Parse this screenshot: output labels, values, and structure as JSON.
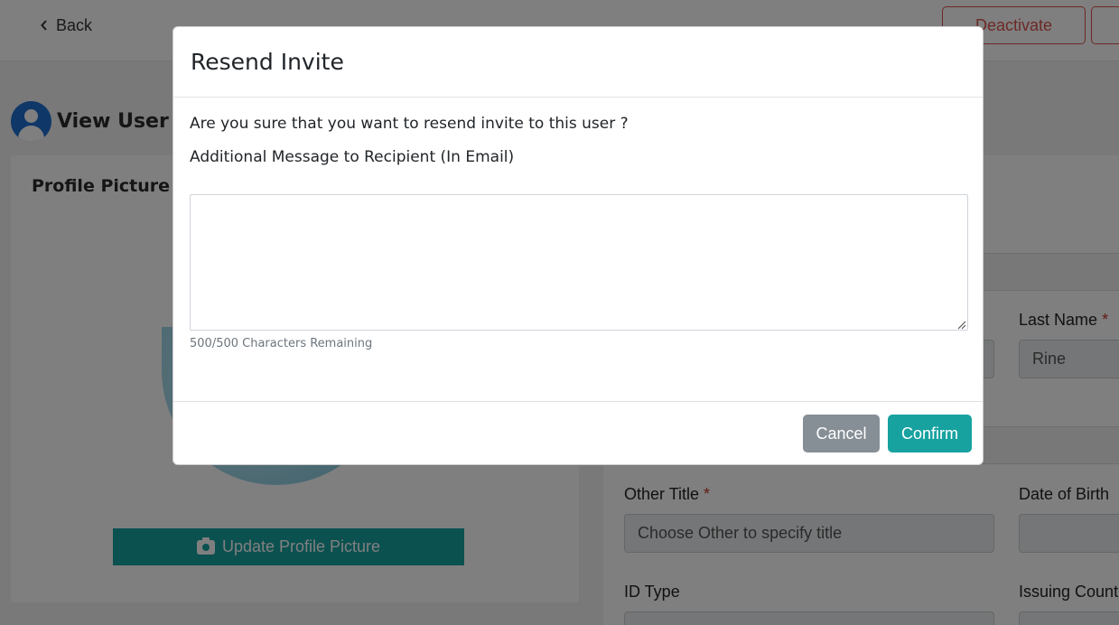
{
  "header": {
    "back_label": "Back",
    "deactivate_label": "Deactivate"
  },
  "page": {
    "title": "View User"
  },
  "profile_card": {
    "title": "Profile Picture",
    "update_button": "Update Profile Picture"
  },
  "form": {
    "last_name_label": "Last Name",
    "last_name_value": "Rine",
    "other_title_label": "Other Title",
    "other_title_placeholder": "Choose Other to specify title",
    "dob_label": "Date of Birth",
    "id_type_label": "ID Type",
    "issuing_country_label": "Issuing Count",
    "required_marker": "*"
  },
  "modal": {
    "title": "Resend Invite",
    "confirm_text": "Are you sure that you want to resend invite to this user ?",
    "message_label": "Additional Message to Recipient (In Email)",
    "message_value": "",
    "char_counter": "500/500 Characters Remaining",
    "cancel_label": "Cancel",
    "confirm_label": "Confirm"
  },
  "colors": {
    "accent": "#17a2a0",
    "danger": "#d9534f",
    "secondary": "#868e96",
    "avatar": "#1f6fd1"
  }
}
